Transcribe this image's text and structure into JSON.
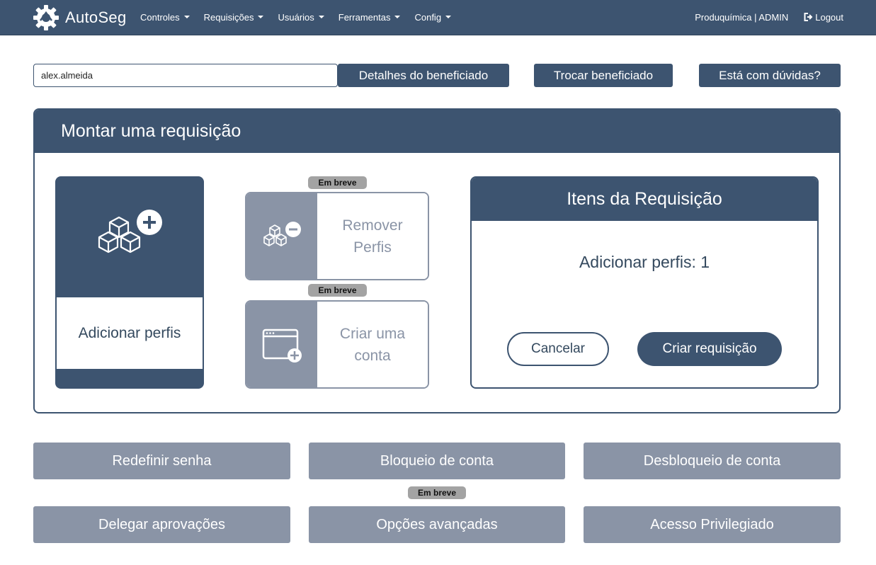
{
  "navbar": {
    "brand": "AutoSeg",
    "menu": [
      {
        "label": "Controles"
      },
      {
        "label": "Requisições"
      },
      {
        "label": "Usuários"
      },
      {
        "label": "Ferramentas"
      },
      {
        "label": "Config"
      }
    ],
    "user": "Produquímica | ADMIN",
    "logout": "Logout"
  },
  "search": {
    "value": "alex.almeida"
  },
  "top_buttons": {
    "details": "Detalhes do beneficiado",
    "change": "Trocar beneficiado",
    "help": "Está com dúvidas?"
  },
  "panel": {
    "title": "Montar uma requisição",
    "add_card": {
      "label": "Adicionar perfis"
    },
    "remove_card": {
      "line1": "Remover",
      "line2": "Perfis",
      "badge": "Em breve"
    },
    "create_account_card": {
      "line1": "Criar uma",
      "line2": "conta",
      "badge": "Em breve"
    },
    "items": {
      "title": "Itens da Requisição",
      "line": "Adicionar perfis: 1",
      "cancel": "Cancelar",
      "create": "Criar requisição"
    }
  },
  "actions": {
    "reset_password": "Redefinir senha",
    "block_account": "Bloqueio de conta",
    "unblock_account": "Desbloqueio de conta",
    "delegate": "Delegar aprovações",
    "advanced": "Opções avançadas",
    "advanced_badge": "Em breve",
    "privileged": "Acesso Privilegiado"
  },
  "colors": {
    "primary": "#3d5470",
    "disabled": "#8a94a6",
    "badge": "#a3a3a3"
  }
}
